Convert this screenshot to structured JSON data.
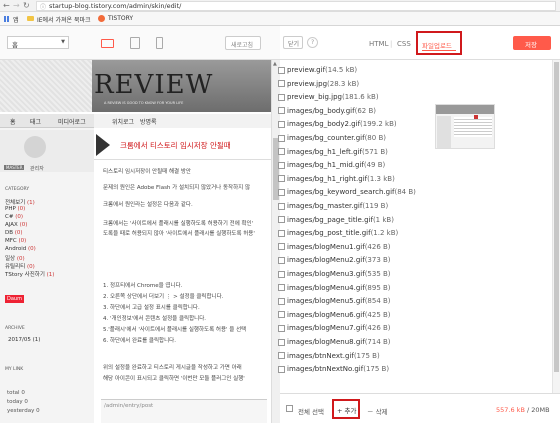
{
  "browser": {
    "url": "startup-blog.tistory.com/admin/skin/edit/",
    "bookmarks": [
      "앱",
      "IE에서 가져온 북마크",
      "TISTORY"
    ]
  },
  "toolbar": {
    "select_value": "홈",
    "refresh_label": "새로고침"
  },
  "editor": {
    "close_label": "닫기",
    "help_label": "?",
    "tabs": [
      "HTML",
      "CSS",
      "파일업로드"
    ],
    "apply_label": "저장"
  },
  "blog": {
    "logo": "REVIEW",
    "tagline": "A REVIEW IS GOOD TO KNOW FOR YOUR LIFE",
    "nav": [
      "홈",
      "태그",
      "미디어로그",
      "위치로그",
      "방명록"
    ],
    "nickname": "MASTER",
    "profile_label": "관리자",
    "post_title": "크롬에서 티스토리 임시저장 안될때",
    "category_label": "CATEGORY",
    "categories": [
      {
        "label": "전체보기",
        "count": "(1)"
      },
      {
        "label": "PHP",
        "count": "(0)"
      },
      {
        "label": "C#",
        "count": "(0)"
      },
      {
        "label": "AJAX",
        "count": "(0)"
      },
      {
        "label": "DB",
        "count": "(0)"
      },
      {
        "label": "MFC",
        "count": "(0)"
      },
      {
        "label": "Android",
        "count": "(0)"
      },
      {
        "label": "일상",
        "count": "(0)"
      },
      {
        "label": "유틸리티",
        "count": "(0)"
      },
      {
        "label": "TStory 사진하기",
        "count": "(1)"
      }
    ],
    "badge": "Daum",
    "archive_label": "ARCHIVE",
    "archive_item": "2017/05 (1)",
    "visitors_label": "MY LINK",
    "visitors": [
      "total 0",
      "today 0",
      "yesterday 0"
    ],
    "article": [
      "티스토리 임시저장이 안될때 해결 방안",
      "문제의 원인은 Adobe Flash 가 설치되지 않았거나 동작하지 않",
      "크롬에서 원인라는 설정은 다음과 같다.",
      "크롬에서는 '사이트에서 플래시를 실행하도록 허용하기 전에 확인'",
      "도록을 때로 허용되지 않아 '사이트에서 플래시를 실행하도록 허용'",
      "1. 정프티에서 Chrome을 엽니다.",
      "2. 오른쪽 상단에서 더보기 ⋮ > 설정을 클릭합니다.",
      "3. 하단에서 고급 설정 표시를 클릭합니다.",
      "4. '개인정보'에서 콘텐츠 설정을 클릭합니다.",
      "5.'플래시'에서 '사이트에서 플래시를 실행하도록 허용' 을 선택",
      "6. 하단에서 완료를 클릭합니다.",
      "위의 설정을 완료하고 티스토리 게시글을 작성하고 가면 아래",
      "해당 아이콘이 표시되고 클릭하면 '이번만 모듈 플러그인 실행'"
    ],
    "admin_link": "/admin/entry/post"
  },
  "files": [
    {
      "name": "preview.gif",
      "size": "(14.5 kB)"
    },
    {
      "name": "preview.jpg",
      "size": "(28.3 kB)"
    },
    {
      "name": "preview_big.jpg",
      "size": "(181.6 kB)"
    },
    {
      "name": "images/bg_body.gif",
      "size": "(62 B)"
    },
    {
      "name": "images/bg_body2.gif",
      "size": "(199.2 kB)"
    },
    {
      "name": "images/bg_counter.gif",
      "size": "(80 B)"
    },
    {
      "name": "images/bg_h1_left.gif",
      "size": "(571 B)"
    },
    {
      "name": "images/bg_h1_mid.gif",
      "size": "(49 B)"
    },
    {
      "name": "images/bg_h1_right.gif",
      "size": "(1.3 kB)"
    },
    {
      "name": "images/bg_keyword_search.gif",
      "size": "(84 B)"
    },
    {
      "name": "images/bg_master.gif",
      "size": "(119 B)"
    },
    {
      "name": "images/bg_page_title.gif",
      "size": "(1 kB)"
    },
    {
      "name": "images/bg_post_title.gif",
      "size": "(1.2 kB)"
    },
    {
      "name": "images/blogMenu1.gif",
      "size": "(426 B)"
    },
    {
      "name": "images/blogMenu2.gif",
      "size": "(373 B)"
    },
    {
      "name": "images/blogMenu3.gif",
      "size": "(535 B)"
    },
    {
      "name": "images/blogMenu4.gif",
      "size": "(895 B)"
    },
    {
      "name": "images/blogMenu5.gif",
      "size": "(854 B)"
    },
    {
      "name": "images/blogMenu6.gif",
      "size": "(425 B)"
    },
    {
      "name": "images/blogMenu7.gif",
      "size": "(426 B)"
    },
    {
      "name": "images/blogMenu8.gif",
      "size": "(714 B)"
    },
    {
      "name": "images/btnNext.gif",
      "size": "(175 B)"
    },
    {
      "name": "images/btnNextNo.gif",
      "size": "(175 B)"
    }
  ],
  "footer": {
    "select_all": "전체 선택",
    "add_label": "+ 추가",
    "delete_label": "－ 삭제",
    "used": "557.6 kB",
    "total": "/ 20MB"
  },
  "colors": {
    "accent": "#ff5a4a",
    "highlight": "#d0191c"
  }
}
